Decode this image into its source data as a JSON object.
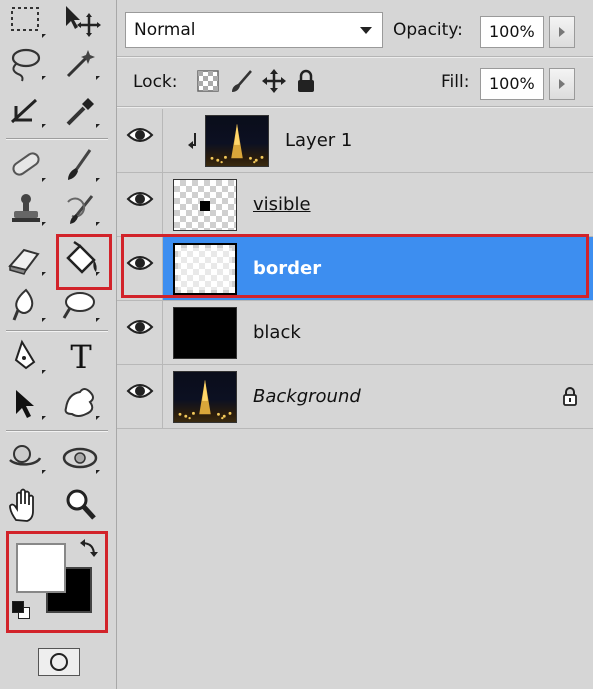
{
  "blend_mode": "Normal",
  "opacity": {
    "label": "Opacity:",
    "value": "100%"
  },
  "lock": {
    "label": "Lock:"
  },
  "fill": {
    "label": "Fill:",
    "value": "100%"
  },
  "layers": [
    {
      "name": "Layer 1",
      "visible": true,
      "clipped": true
    },
    {
      "name": "visible",
      "visible": true
    },
    {
      "name": "border",
      "visible": true,
      "selected": true
    },
    {
      "name": "black",
      "visible": true
    },
    {
      "name": "Background",
      "visible": true,
      "locked": true
    }
  ],
  "colors": {
    "accent": "#3d8ef0",
    "highlight": "#d2232a",
    "foreground_color": "#ffffff",
    "background_color": "#000000"
  },
  "tools": [
    "marquee-tool-icon",
    "move-tool-icon",
    "lasso-tool-icon",
    "magic-wand-tool-icon",
    "crop-tool-icon",
    "eyedropper-tool-icon",
    "healing-brush-tool-icon",
    "brush-tool-icon",
    "clone-stamp-tool-icon",
    "history-brush-tool-icon",
    "eraser-tool-icon",
    "paint-bucket-tool-icon",
    "blur-tool-icon",
    "dodge-tool-icon",
    "pen-tool-icon",
    "type-tool-icon",
    "path-selection-tool-icon",
    "custom-shape-tool-icon",
    "rotate-3d-tool-icon",
    "orbit-3d-tool-icon",
    "hand-tool-icon",
    "zoom-tool-icon"
  ],
  "type_tool_glyph": "T"
}
